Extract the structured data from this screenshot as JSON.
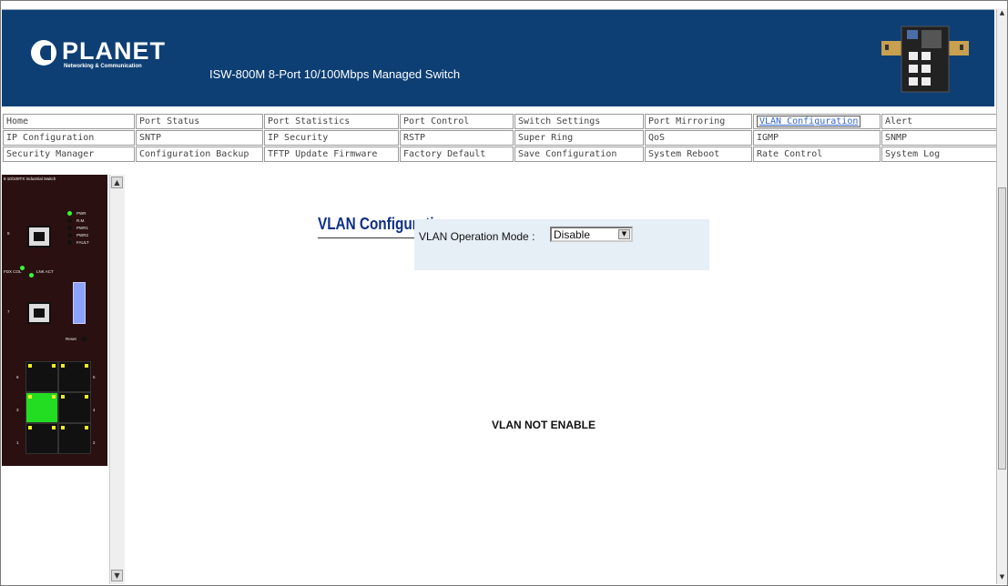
{
  "header": {
    "logo_text": "PLANET",
    "logo_subtext": "Networking & Communication",
    "product_title": "ISW-800M 8-Port 10/100Mbps Managed Switch"
  },
  "nav": {
    "rows": [
      [
        "Home",
        "Port Status",
        "Port Statistics",
        "Port Control",
        "Switch Settings",
        "Port Mirroring",
        "VLAN Configuration",
        "Alert"
      ],
      [
        "IP Configuration",
        "SNTP",
        "IP Security",
        "RSTP",
        "Super Ring",
        "QoS",
        "IGMP",
        "SNMP"
      ],
      [
        "Security Manager",
        "Configuration Backup",
        "TFTP Update Firmware",
        "Factory Default",
        "Save Configuration",
        "System Reboot",
        "Rate Control",
        "System Log"
      ]
    ],
    "active": "VLAN Configuration"
  },
  "device_panel": {
    "title": "8 10/100TX Industrial Switch",
    "labels": {
      "pwr": "PWR",
      "rm": "R.M.",
      "pwr1": "PWR1",
      "pwr2": "PWR2",
      "fault": "FAULT",
      "fdx_col": "FDX COL",
      "lnk_act": "LNK ACT",
      "reset": "Reset"
    },
    "port_numbers": [
      "8",
      "7",
      "6",
      "5",
      "4",
      "3",
      "2",
      "1"
    ]
  },
  "main": {
    "title": "VLAN Configuration",
    "mode_label": "VLAN Operation Mode :",
    "mode_value": "Disable",
    "status_text": "VLAN NOT ENABLE"
  },
  "colors": {
    "header_bg": "#0d3f74",
    "title_color": "#0d2f86",
    "active_link": "#3366cc",
    "mode_box_bg": "#e6eef6"
  }
}
